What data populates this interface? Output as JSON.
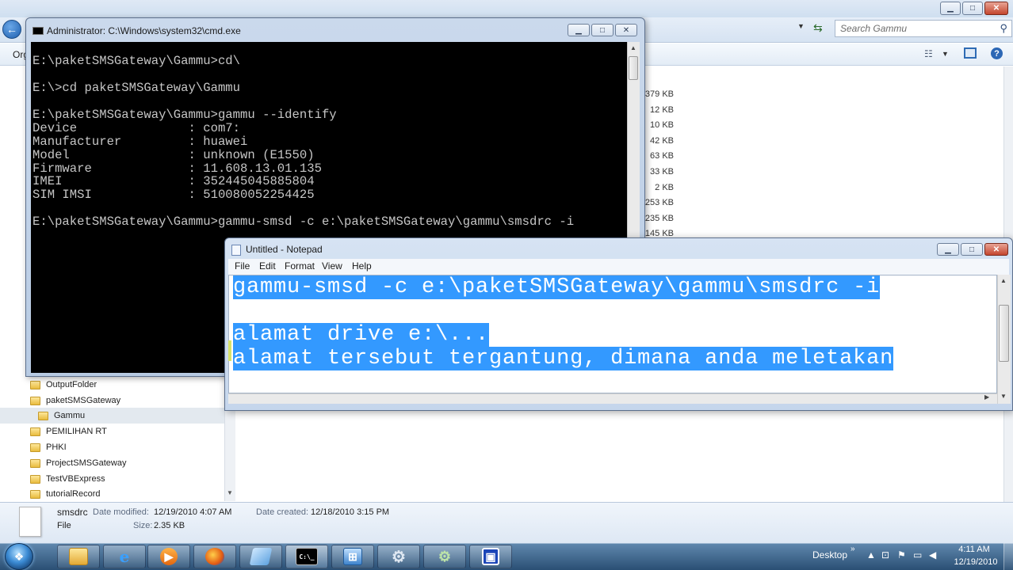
{
  "explorer": {
    "search_placeholder": "Search Gammu",
    "organize_label": "Org",
    "sizes": [
      "379 KB",
      "12 KB",
      "10 KB",
      "42 KB",
      "63 KB",
      "33 KB",
      "2 KB",
      "253 KB",
      "235 KB",
      "145 KB"
    ],
    "tree": [
      {
        "label": "OutputFolder"
      },
      {
        "label": "paketSMSGateway"
      },
      {
        "label": "Gammu"
      },
      {
        "label": "PEMILIHAN RT"
      },
      {
        "label": "PHKI"
      },
      {
        "label": "ProjectSMSGateway"
      },
      {
        "label": "TestVBExpress"
      },
      {
        "label": "tutorialRecord"
      }
    ],
    "details": {
      "name": "smsdrc",
      "type": "File",
      "modified_label": "Date modified:",
      "modified_value": "12/19/2010 4:07 AM",
      "size_label": "Size:",
      "size_value": "2.35 KB",
      "created_label": "Date created:",
      "created_value": "12/18/2010 3:15 PM"
    }
  },
  "cmd": {
    "title": "Administrator: C:\\Windows\\system32\\cmd.exe",
    "lines": [
      "E:\\paketSMSGateway\\Gammu>cd\\",
      "",
      "E:\\>cd paketSMSGateway\\Gammu",
      "",
      "E:\\paketSMSGateway\\Gammu>gammu --identify",
      "Device               : com7:",
      "Manufacturer         : huawei",
      "Model                : unknown (E1550)",
      "Firmware             : 11.608.13.01.135",
      "IMEI                 : 352445045885804",
      "SIM IMSI             : 510080052254425",
      "",
      "E:\\paketSMSGateway\\Gammu>gammu-smsd -c e:\\paketSMSGateway\\gammu\\smsdrc -i"
    ]
  },
  "notepad": {
    "title": "Untitled - Notepad",
    "menu": [
      "File",
      "Edit",
      "Format",
      "View",
      "Help"
    ],
    "lines": [
      "gammu-smsd -c e:\\paketSMSGateway\\gammu\\smsdrc -i",
      "",
      "alamat drive e:\\...",
      "alamat tersebut tergantung, dimana anda meletakan"
    ]
  },
  "taskbar": {
    "desktop_label": "Desktop",
    "time": "4:11 AM",
    "date": "12/19/2010",
    "cmd_glyph": "C:\\_"
  },
  "colors": {
    "selection": "#3399ff",
    "console_bg": "#000000",
    "console_text": "#c6c6c6"
  }
}
